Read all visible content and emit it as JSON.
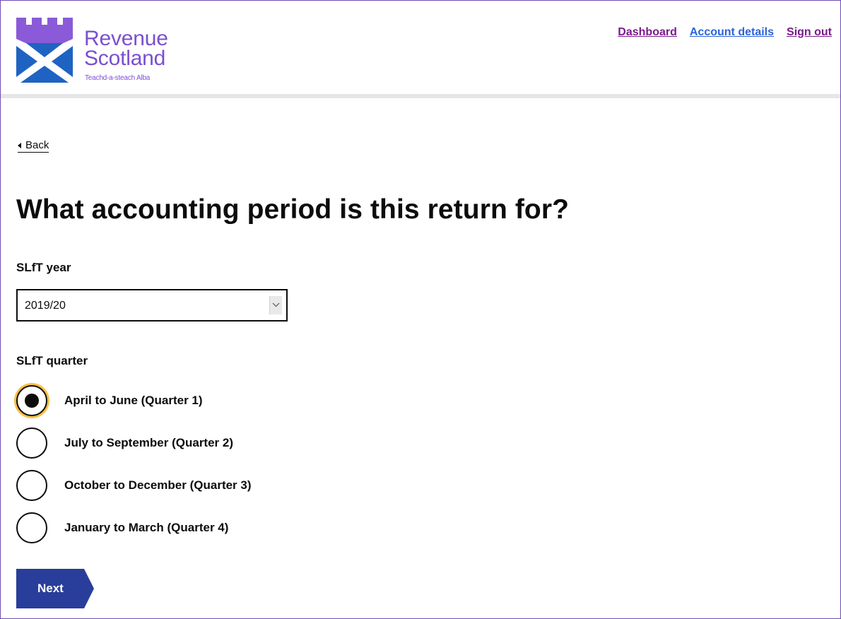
{
  "header": {
    "logo_line1": "Revenue",
    "logo_line2": "Scotland",
    "logo_tagline": "Teachd-a-steach Alba",
    "nav": {
      "dashboard": "Dashboard",
      "account_details": "Account details",
      "sign_out": "Sign out"
    }
  },
  "back_label": "Back",
  "page_title": "What accounting period is this return for?",
  "year": {
    "label": "SLfT year",
    "selected": "2019/20"
  },
  "quarter": {
    "label": "SLfT quarter",
    "options": [
      {
        "label": "April to June (Quarter 1)",
        "checked": true
      },
      {
        "label": "July to September (Quarter 2)",
        "checked": false
      },
      {
        "label": "October to December (Quarter 3)",
        "checked": false
      },
      {
        "label": "January to March (Quarter 4)",
        "checked": false
      }
    ]
  },
  "next_label": "Next",
  "colors": {
    "brand_purple": "#7b4fd0",
    "saltire_blue": "#1a5fb4",
    "button_blue": "#293e9a",
    "focus_yellow": "#ffbf47"
  }
}
